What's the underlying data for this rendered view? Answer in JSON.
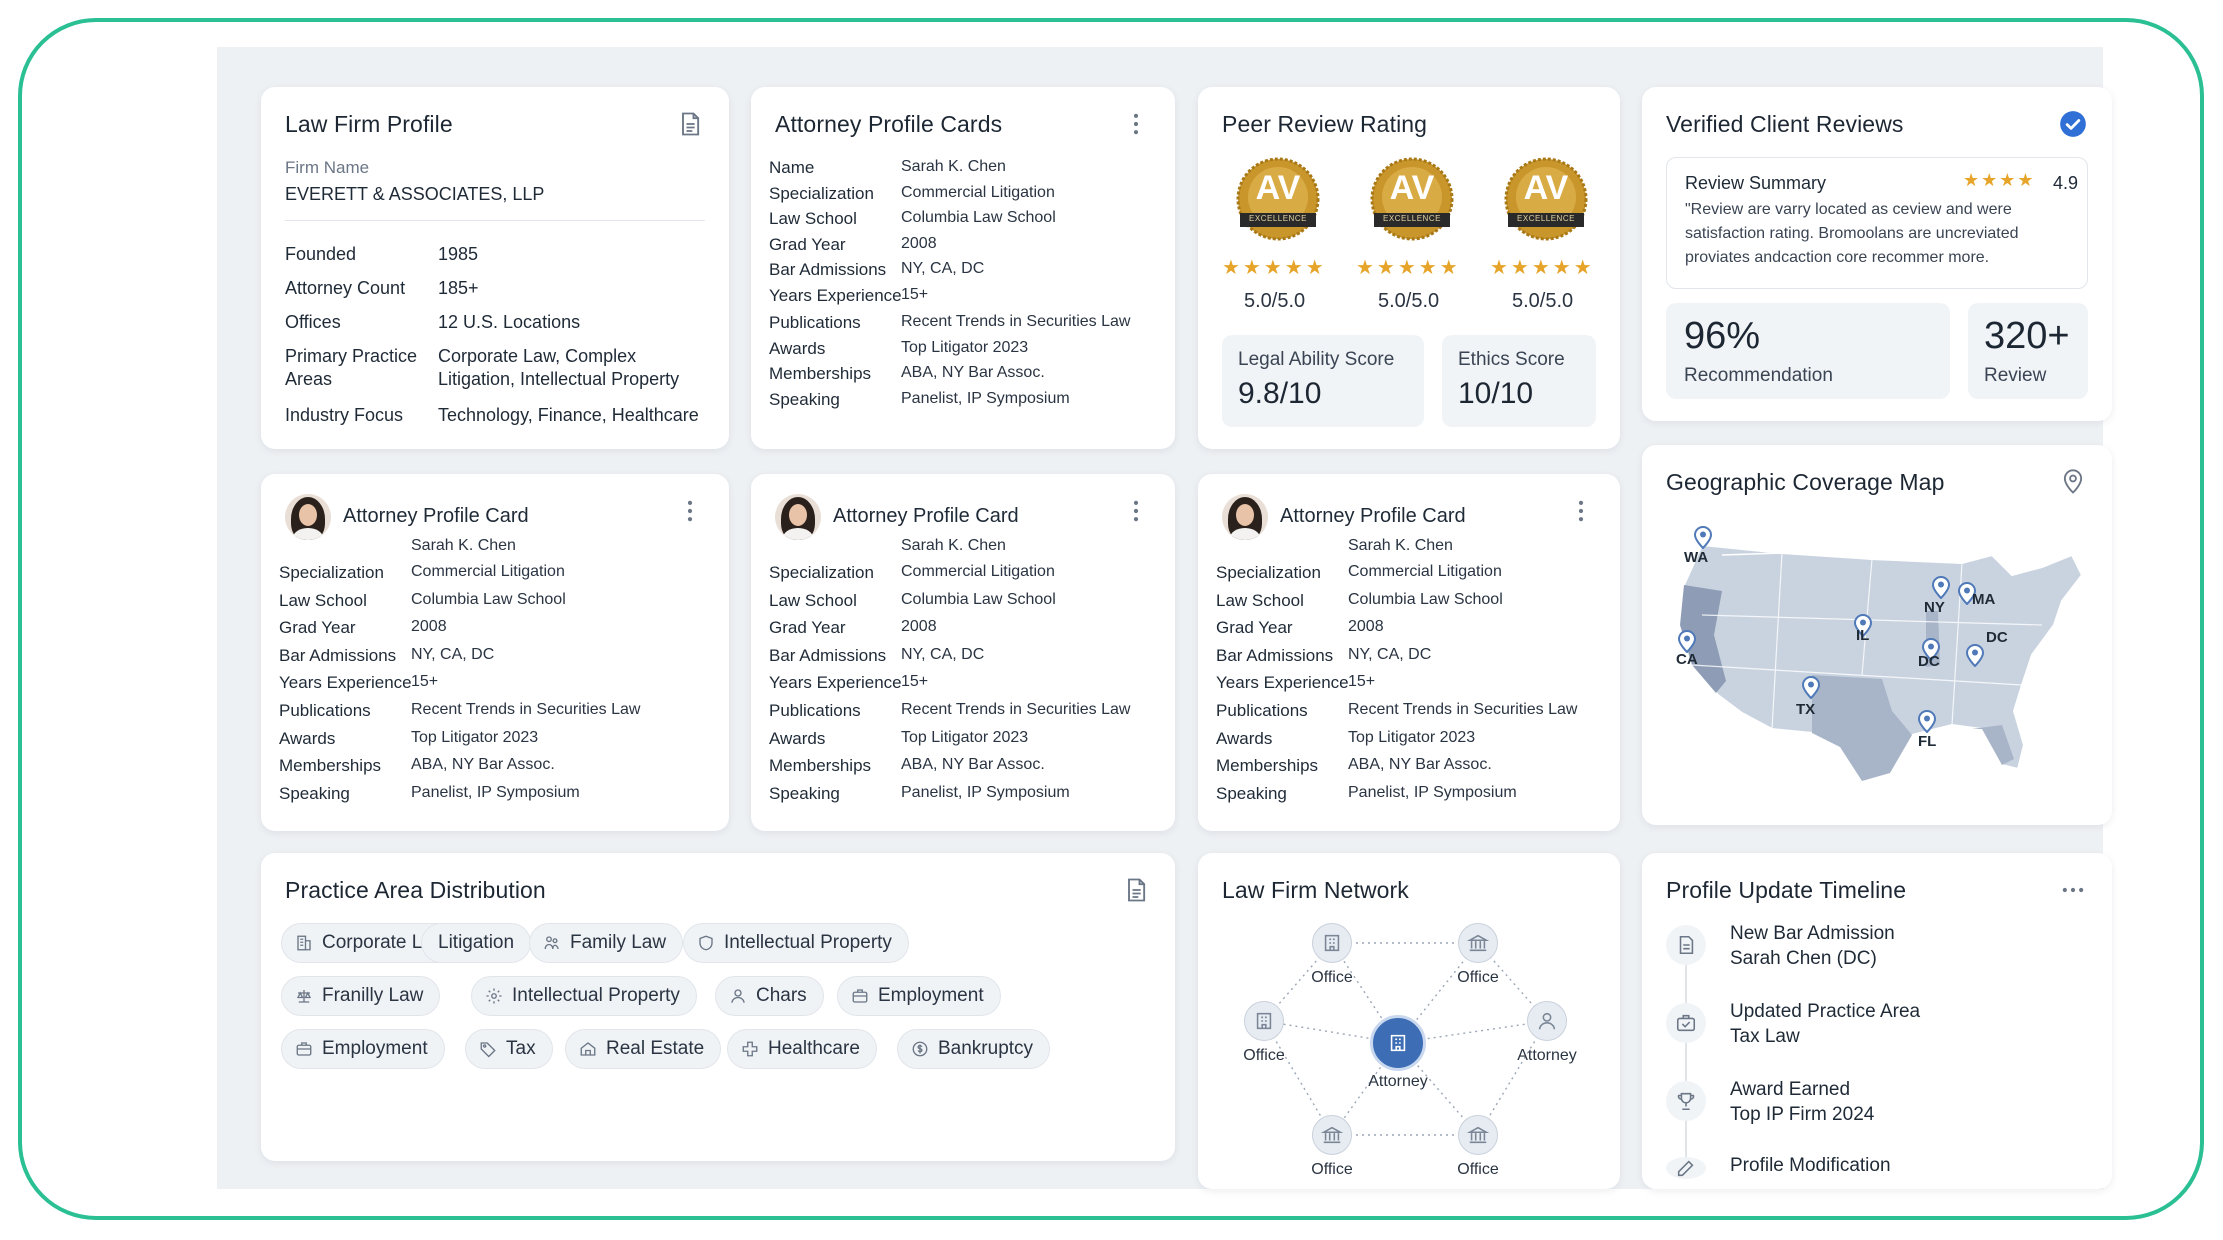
{
  "firm_profile": {
    "title": "Law Firm Profile",
    "firm_name_label": "Firm Name",
    "firm_name": "EVERETT & ASSOCIATES, LLP",
    "rows": [
      {
        "label": "Founded",
        "value": "1985"
      },
      {
        "label": "Attorney Count",
        "value": "185+"
      },
      {
        "label": "Offices",
        "value": "12 U.S. Locations"
      },
      {
        "label": "Primary Practice",
        "label2": "Areas",
        "value": "Corporate Law, Complex",
        "value2": "Litigation, Intellectual Property"
      },
      {
        "label": "Industry Focus",
        "value": "Technology, Finance, Healthcare"
      }
    ]
  },
  "attorney_cards_main": {
    "title": "Attorney Profile Cards",
    "rows": [
      {
        "label": "Name",
        "value": "Sarah K. Chen"
      },
      {
        "label": "Specialization",
        "value": "Commercial Litigation"
      },
      {
        "label": "Law School",
        "value": "Columbia Law School"
      },
      {
        "label": "Grad Year",
        "value": "2008"
      },
      {
        "label": "Bar Admissions",
        "value": "NY, CA, DC"
      },
      {
        "label": "Years Experience",
        "value": "15+"
      },
      {
        "label": "Publications",
        "value": "Recent Trends in Securities Law"
      },
      {
        "label": "Awards",
        "value": "Top Litigator 2023"
      },
      {
        "label": "Memberships",
        "value": "ABA, NY Bar Assoc."
      },
      {
        "label": "Speaking",
        "value": "Panelist, IP Symposium"
      }
    ]
  },
  "attorney_card": {
    "title": "Attorney Profile Card",
    "name": "Sarah K. Chen",
    "rows": [
      {
        "label": "Specialization",
        "value": "Commercial Litigation"
      },
      {
        "label": "Law School",
        "value": "Columbia Law School"
      },
      {
        "label": "Grad Year",
        "value": "2008"
      },
      {
        "label": "Bar Admissions",
        "value": "NY, CA, DC"
      },
      {
        "label": "Years Experience",
        "value": "15+"
      },
      {
        "label": "Publications",
        "value": "Recent Trends in Securities Law"
      },
      {
        "label": "Awards",
        "value": "Top Litigator 2023"
      },
      {
        "label": "Memberships",
        "value": "ABA, NY Bar Assoc."
      },
      {
        "label": "Speaking",
        "value": "Panelist, IP Symposium"
      }
    ]
  },
  "peer_review": {
    "title": "Peer Review Rating",
    "badges": [
      {
        "mark": "AV",
        "ribbon": "EXCELLENCE",
        "stars": "★★★★★",
        "score": "5.0/5.0"
      },
      {
        "mark": "AV",
        "ribbon": "EXCELLENCE",
        "stars": "★★★★★",
        "score": "5.0/5.0"
      },
      {
        "mark": "AV",
        "ribbon": "EXCELLENCE",
        "stars": "★★★★★",
        "score": "5.0/5.0"
      }
    ],
    "legal_ability_label": "Legal Ability Score",
    "legal_ability_value": "9.8/10",
    "ethics_label": "Ethics Score",
    "ethics_value": "10/10",
    "gold": "#c9962b"
  },
  "client_reviews": {
    "title": "Verified Client Reviews",
    "summary_label": "Review Summary",
    "stars": "★★★★",
    "rating": "4.9",
    "summary_line1": "\"Review are varry located as ceview and were",
    "summary_line2": "satisfaction rating.  Bromoolans are uncreviated",
    "summary_line3": "proviates andcaction core recommer more.",
    "recommendation_value": "96%",
    "recommendation_label": "Recommendation",
    "review_count": "320+",
    "review_label": "Review",
    "verified_color": "#2f6fd6"
  },
  "coverage_map": {
    "title": "Geographic Coverage Map",
    "states": [
      "WA",
      "NY",
      "MA",
      "IL",
      "DC",
      "CA",
      "DC",
      "TX",
      "FL"
    ],
    "map_fill": "#c9d3e0",
    "highlight_fill": "#8e9db5"
  },
  "practice_areas": {
    "title": "Practice Area Distribution",
    "chips": [
      {
        "label": "Corporate Law",
        "icon": "building-icon"
      },
      {
        "label": "Litigation",
        "icon": ""
      },
      {
        "label": "Family Law",
        "icon": "family-icon"
      },
      {
        "label": "Intellectual Property",
        "icon": "shield-icon"
      },
      {
        "label": "Franilly Law",
        "icon": "scale-icon"
      },
      {
        "label": "Intellectual Property",
        "icon": "gear-icon"
      },
      {
        "label": "Chars",
        "icon": "user-icon"
      },
      {
        "label": "Employment",
        "icon": "briefcase-icon"
      },
      {
        "label": "Employment",
        "icon": "briefcase-icon"
      },
      {
        "label": "Tax",
        "icon": "tag-icon"
      },
      {
        "label": "Real Estate",
        "icon": "home-icon"
      },
      {
        "label": "Healthcare",
        "icon": "plus-icon"
      },
      {
        "label": "Bankruptcy",
        "icon": "coin-icon"
      }
    ]
  },
  "network": {
    "title": "Law Firm Network",
    "center_label": "Attorney",
    "nodes": [
      {
        "label": "Office"
      },
      {
        "label": "Office"
      },
      {
        "label": "Office"
      },
      {
        "label": "Attorney"
      },
      {
        "label": "Office"
      },
      {
        "label": "Office"
      }
    ]
  },
  "timeline": {
    "title": "Profile Update Timeline",
    "items": [
      {
        "line1": "New Bar Admission",
        "line2": "Sarah Chen (DC)"
      },
      {
        "line1": "Updated Practice Area",
        "line2": "Tax Law"
      },
      {
        "line1": "Award Earned",
        "line2": "Top IP Firm 2024"
      },
      {
        "line1": "Profile Modification",
        "line2": ""
      }
    ]
  }
}
